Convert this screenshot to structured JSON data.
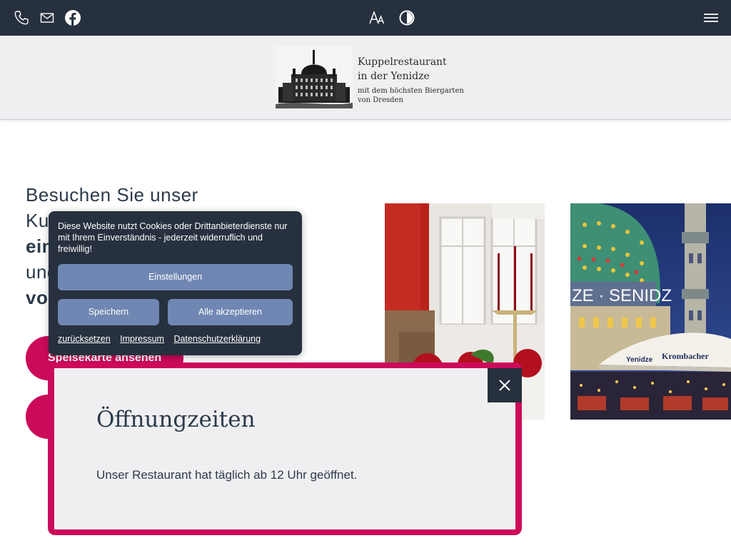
{
  "topbar": {
    "icons": [
      "phone-icon",
      "mail-icon",
      "facebook-icon",
      "font-size-icon",
      "contrast-icon",
      "menu-icon"
    ],
    "bg_color": "#27303e"
  },
  "logo": {
    "line1": "Kuppelrestaurant",
    "line2": "in der Yenidze",
    "line3": "mit dem höchsten Biergarten",
    "line4": "von Dresden"
  },
  "hero": {
    "line1": "Besuchen Sie unser",
    "line2": "Ku",
    "line3": "ein",
    "line4": "unc",
    "line5": "vor"
  },
  "buttons": {
    "menu_label": "Speisekarte ansehen",
    "accent_color": "#cc0a5a"
  },
  "cookie": {
    "text": "Diese Website nutzt Cookies oder Drittanbieterdienste nur mit Ihrem Einverständnis - jederzeit widerruflich und freiwillig!",
    "settings_label": "Einstellungen",
    "save_label": "Speichern",
    "accept_all_label": "Alle akzeptieren",
    "links": [
      "zurücksetzen",
      "Impressum",
      "Datenschutzerklärung"
    ]
  },
  "modal": {
    "title": "Öffnungzeiten",
    "body": "Unser Restaurant hat täglich ab 12 Uhr geöffnet."
  },
  "photo_right": {
    "dome_text": "ZE · SENIDZ",
    "umbrella_texts": [
      "Yenidze",
      "Krombacher"
    ]
  }
}
